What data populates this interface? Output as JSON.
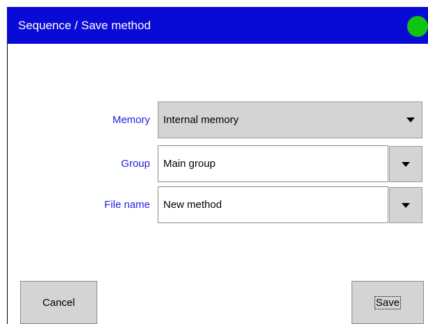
{
  "window": {
    "title": "Sequence / Save method",
    "status_color": "#12c412",
    "accent": "#0a0ad6",
    "label_color": "#2020e8"
  },
  "form": {
    "memory": {
      "label": "Memory",
      "value": "Internal memory",
      "icon": "chevron-down-icon"
    },
    "group": {
      "label": "Group",
      "value": "Main group",
      "icon": "chevron-down-icon"
    },
    "file_name": {
      "label": "File name",
      "value": "New method",
      "icon": "chevron-down-icon"
    }
  },
  "buttons": {
    "cancel_label": "Cancel",
    "save_label": "Save"
  }
}
